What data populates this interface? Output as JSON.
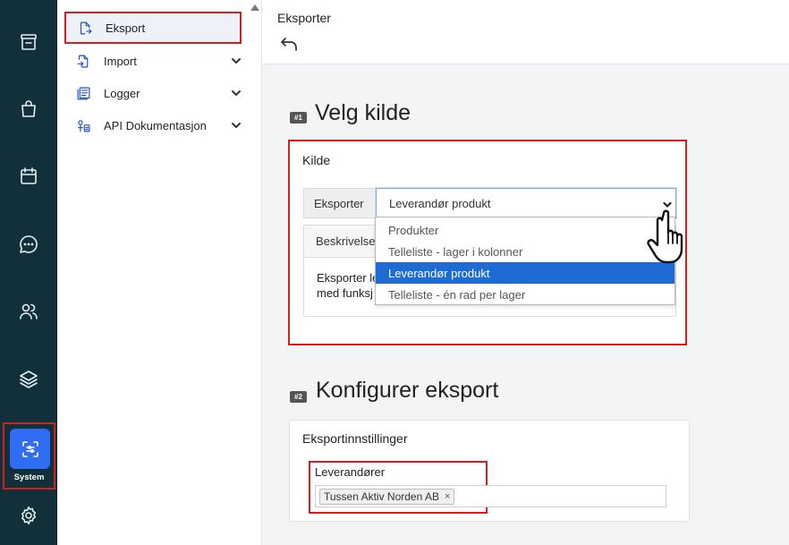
{
  "rail": {
    "system_label": "System"
  },
  "submenu": {
    "items": [
      {
        "label": "Eksport"
      },
      {
        "label": "Import"
      },
      {
        "label": "Logger"
      },
      {
        "label": "API Dokumentasjon"
      }
    ]
  },
  "header": {
    "title": "Eksporter"
  },
  "step1": {
    "badge": "#1",
    "title": "Velg kilde",
    "card_title": "Kilde",
    "addon_label": "Eksporter",
    "selected_value": "Leverandør produkt",
    "options": [
      {
        "label": "Produkter"
      },
      {
        "label": "Telleliste - lager i kolonner"
      },
      {
        "label": "Leverandør produkt"
      },
      {
        "label": "Telleliste - én rad per lager"
      }
    ],
    "description_header": "Beskrivelse",
    "description_line1": "Eksporter le",
    "description_line2": "med funksj"
  },
  "step2": {
    "badge": "#2",
    "title": "Konfigurer eksport",
    "card_title": "Eksportinnstillinger",
    "field_label": "Leverandører",
    "tag_value": "Tussen Aktiv Norden AB",
    "tag_remove": "×"
  },
  "colors": {
    "rail_bg": "#12303a",
    "accent": "#2f6df5",
    "highlight": "#d41f1f",
    "selected_option": "#1f6bd6"
  }
}
